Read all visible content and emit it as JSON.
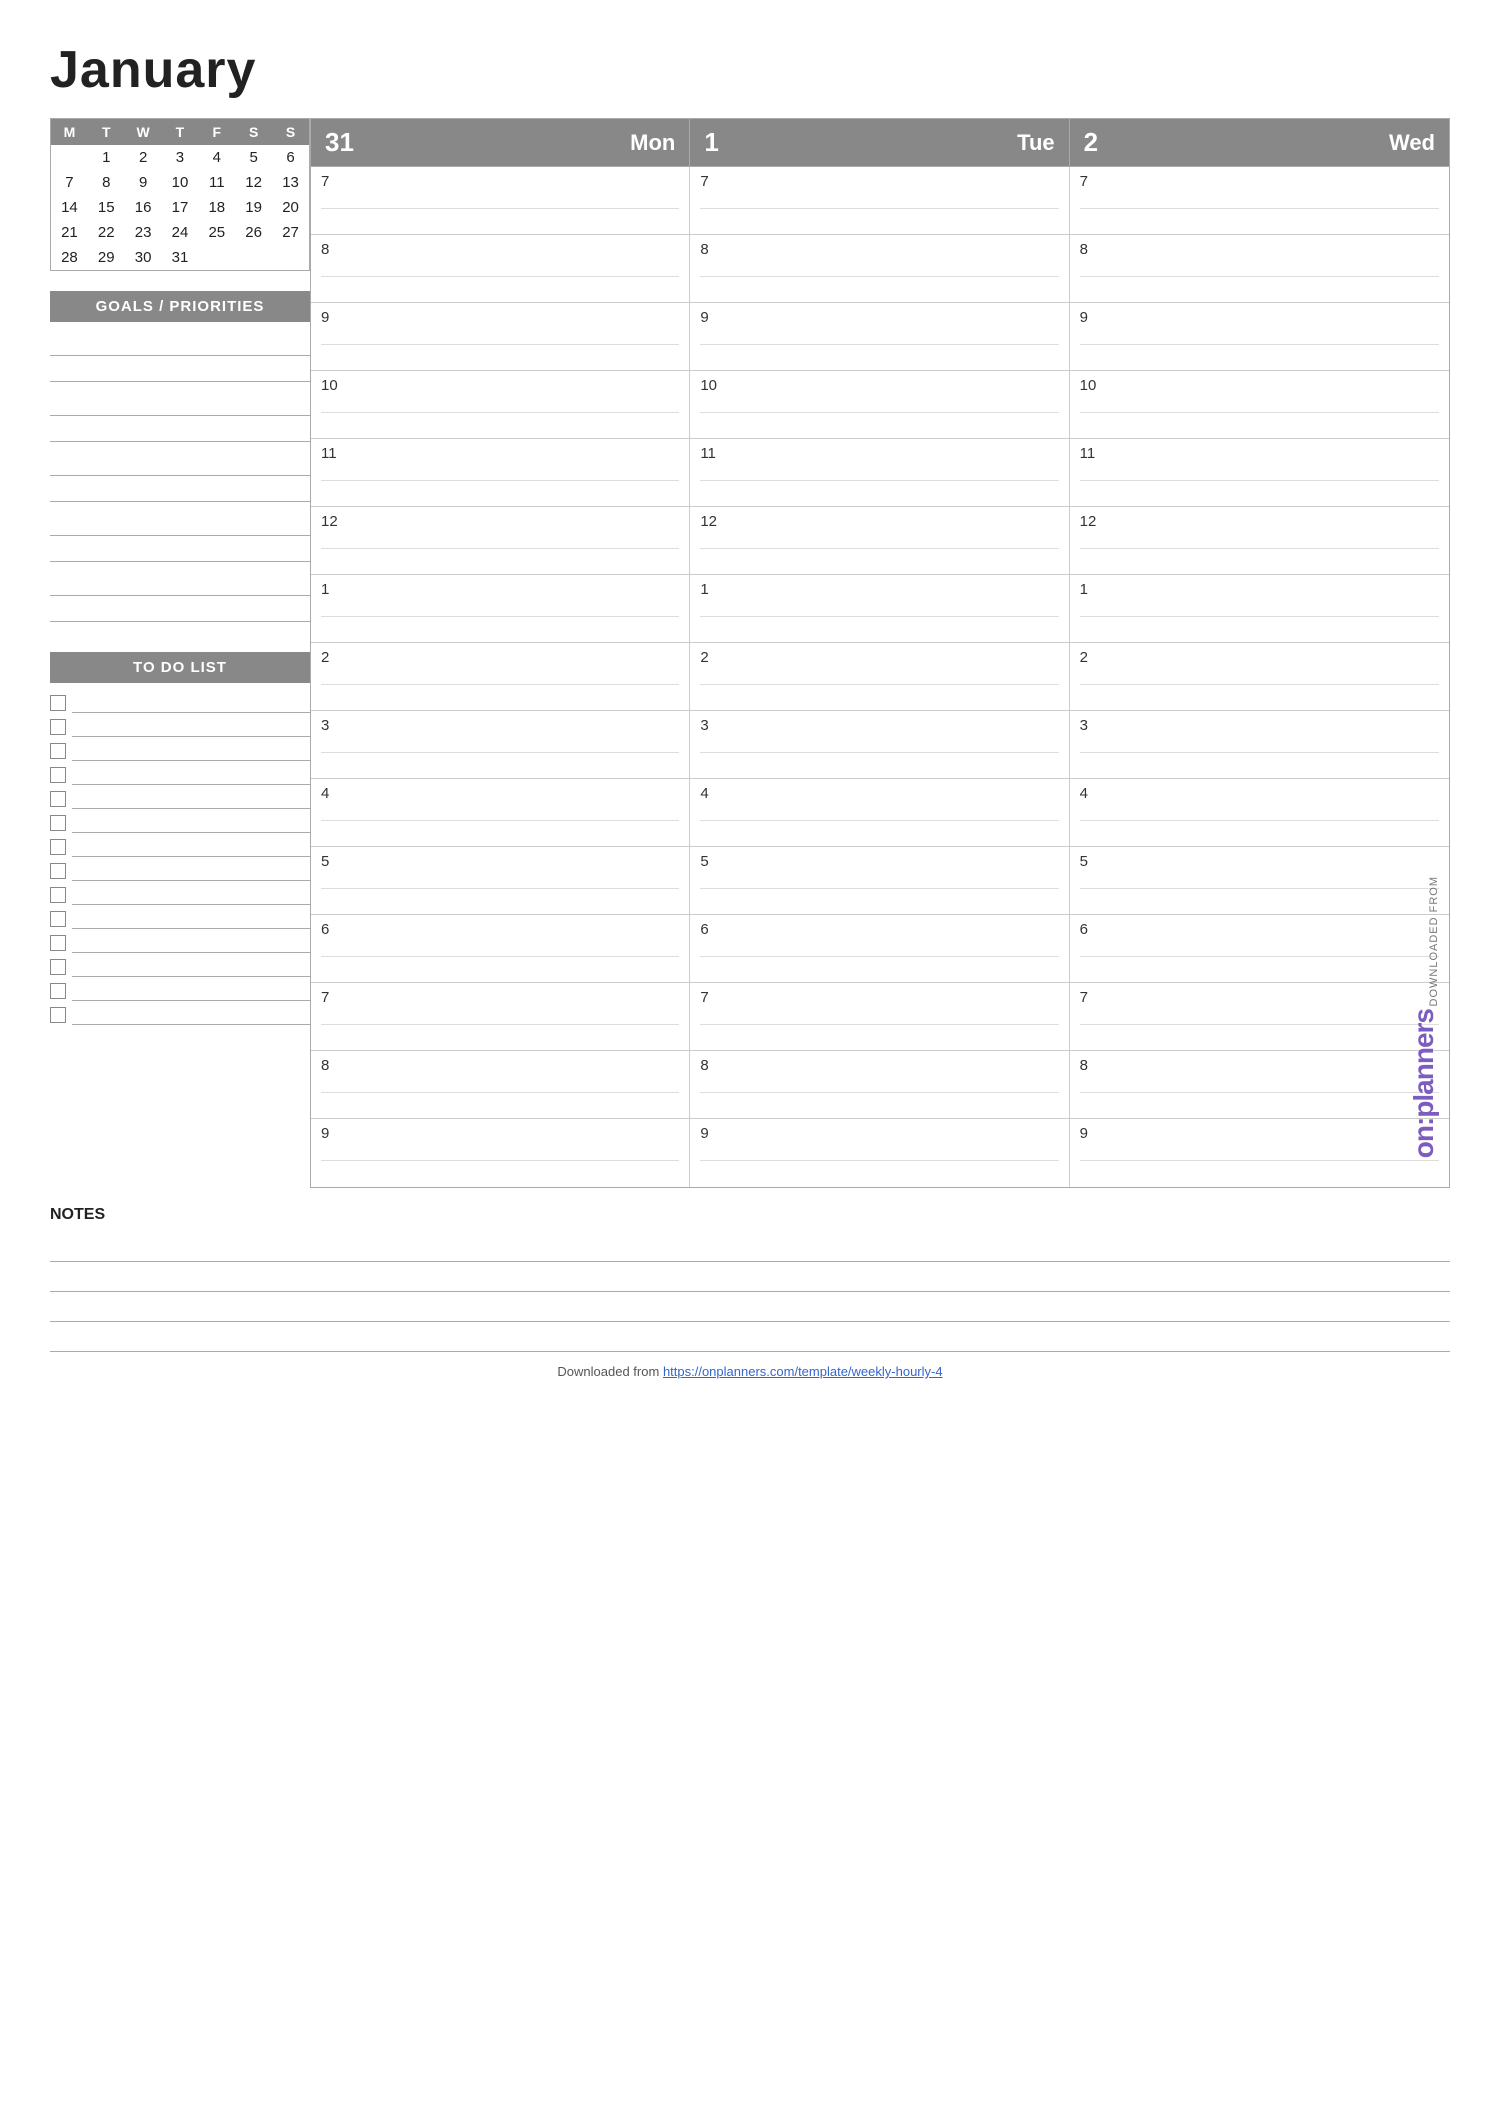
{
  "page": {
    "title": "January"
  },
  "mini_calendar": {
    "headers": [
      "M",
      "T",
      "W",
      "T",
      "F",
      "S",
      "S"
    ],
    "rows": [
      [
        "",
        "1",
        "2",
        "3",
        "4",
        "5",
        "6"
      ],
      [
        "7",
        "8",
        "9",
        "10",
        "11",
        "12",
        "13"
      ],
      [
        "14",
        "15",
        "16",
        "17",
        "18",
        "19",
        "20"
      ],
      [
        "21",
        "22",
        "23",
        "24",
        "25",
        "26",
        "27"
      ],
      [
        "28",
        "29",
        "30",
        "31",
        "",
        "",
        ""
      ]
    ]
  },
  "goals_section": {
    "header": "GOALS / PRIORITIES"
  },
  "todo_section": {
    "header": "TO DO LIST",
    "item_count": 14
  },
  "notes_section": {
    "label": "NOTES",
    "line_count": 4
  },
  "schedule": {
    "days": [
      {
        "num": "31",
        "name": "Mon"
      },
      {
        "num": "1",
        "name": "Tue"
      },
      {
        "num": "2",
        "name": "Wed"
      }
    ],
    "hours": [
      "7",
      "8",
      "9",
      "10",
      "11",
      "12",
      "1",
      "2",
      "3",
      "4",
      "5",
      "6",
      "7",
      "8",
      "9"
    ]
  },
  "brand": {
    "downloaded_text": "DOWNLOADED FROM",
    "logo_on": "on",
    "logo_planners": "planners"
  },
  "footer": {
    "text": "Downloaded from",
    "url": "https://onplanners.com/template/weekly-hourly-4",
    "url_display": "https://onplanners.com/template/weekly-hourly-4"
  }
}
